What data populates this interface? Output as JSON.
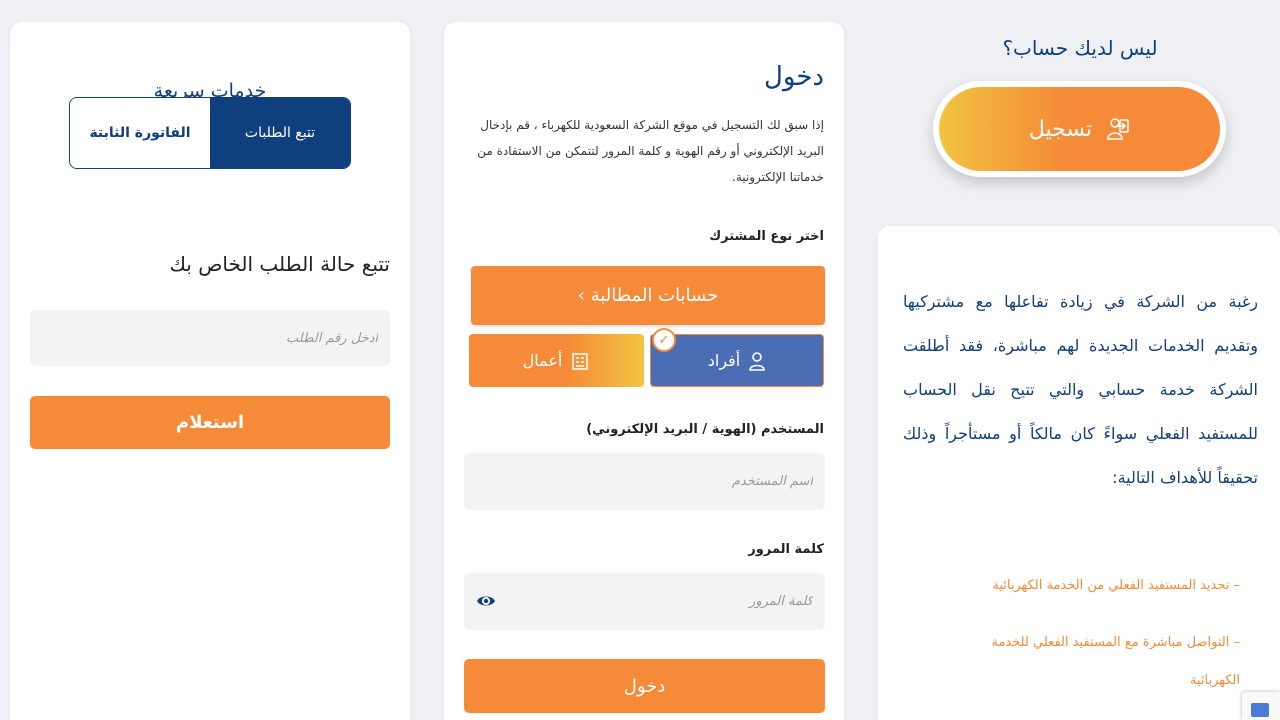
{
  "quick_services": {
    "title": "خدمات سريعة",
    "tabs": [
      {
        "label": "تتبع الطلبات",
        "active": true
      },
      {
        "label": "الفاتورة الثابتة",
        "active": false
      }
    ],
    "track_title": "تتبع حالة الطلب الخاص بك",
    "order_placeholder": "ادخل رقم الطلب",
    "inquiry_label": "استعلام"
  },
  "login": {
    "title": "دخول",
    "description": "إذا سبق لك التسجيل في موقع الشركة السعودية للكهرباء ، قم بإدخال البريد الإلكتروني أو رقم الهوية و كلمة المرور لتتمكن من الاستفادة من خدماتنا الإلكترونية.",
    "subscriber_type_label": "اختر نوع المشترك",
    "billing_accounts_label": "حسابات المطالبة",
    "types": [
      {
        "label": "أفراد",
        "icon": "person-icon",
        "selected": true
      },
      {
        "label": "أعمال",
        "icon": "building-icon",
        "selected": false
      }
    ],
    "username_label": "المستخدم (الهوية / البريد الإلكتروني)",
    "username_placeholder": "اسم المستخدم",
    "password_label": "كلمة المرور",
    "password_placeholder": "كلمة المرور",
    "submit_label": "دخول"
  },
  "signup": {
    "heading": "ليس لديك حساب؟",
    "button_label": "تسجيل",
    "icon": "signup-icon"
  },
  "info": {
    "text": "رغبة من الشركة في زيادة تفاعلها مع مشتركيها وتقديم الخدمات الجديدة لهم مباشرة، فقد أطلقت الشركة خدمة حسابي والتي تتيح نقل الحساب للمستفيد الفعلي سواءً كان مالكاً أو مستأجراً وذلك تحقيقاً للأهداف التالية:",
    "bullets": [
      "– تحديد المستفيد الفعلي من الخدمة الكهربائية",
      "– التواصل مباشرة مع المستفيد الفعلي للخدمة الكهربائية"
    ]
  },
  "colors": {
    "primary_blue": "#0f3f7d",
    "accent_orange": "#f58a38",
    "accent_yellow": "#f2c441",
    "selected_blue": "#4a6db4"
  }
}
